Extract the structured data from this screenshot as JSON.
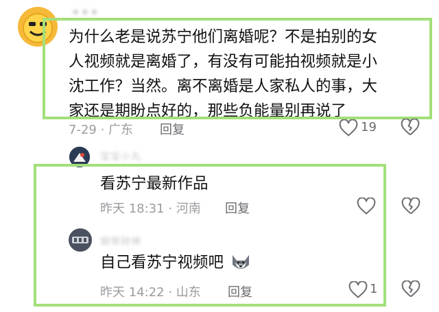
{
  "comments": [
    {
      "author": "★★★",
      "text_lines": [
        "为什么老是说苏宁他们离婚呢？不是拍别的女",
        "人视频就是离婚了，有没有可能拍视频就是小",
        "沈工作？当然。离不离婚是人家私人的事，大",
        "家还是期盼点好的，那些负能量别再说了"
      ],
      "meta": "7-29 · 广东",
      "reply_label": "回复",
      "like_count": "19"
    }
  ],
  "replies": [
    {
      "author": "宝宝小丸",
      "text": "看苏宁最新作品",
      "meta": "昨天 18:31 · 河南",
      "reply_label": "回复",
      "like_count": ""
    },
    {
      "author": "钢琴财神",
      "text": "自己看苏宁视频吧",
      "meta": "昨天 14:22 · 山东",
      "reply_label": "回复",
      "like_count": "1"
    }
  ],
  "colors": {
    "highlight_border": "#a2e07a",
    "meta_text": "#9b9ba0",
    "icon_stroke": "#707075"
  },
  "icons": [
    "heart-icon",
    "broken-heart-icon",
    "husky-emoji-icon"
  ]
}
